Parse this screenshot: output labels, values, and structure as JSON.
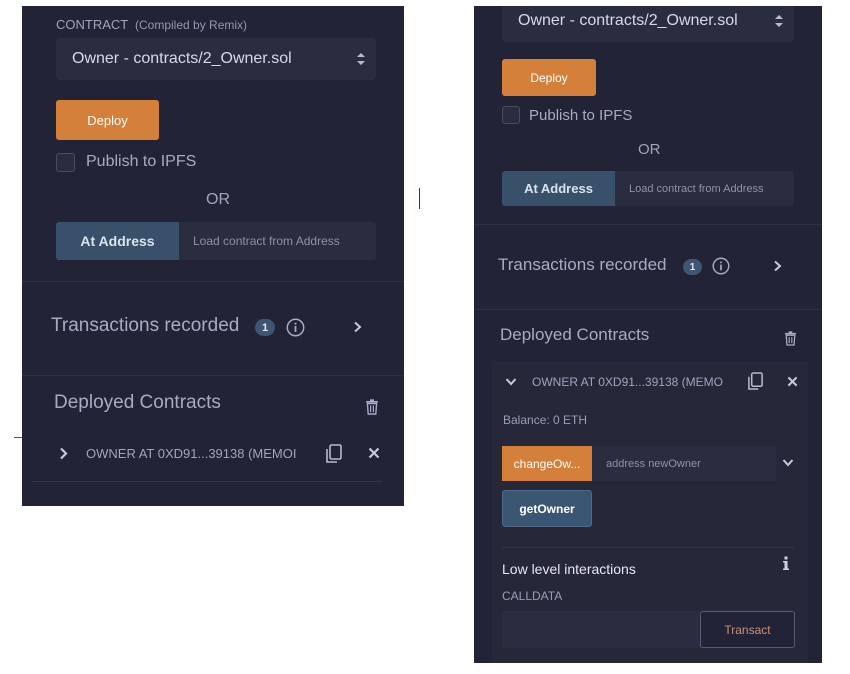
{
  "left": {
    "contract_label": "CONTRACT",
    "compiled_note": "(Compiled by Remix)",
    "contract_select": "Owner - contracts/2_Owner.sol",
    "deploy_label": "Deploy",
    "publish_label": "Publish to IPFS",
    "or_label": "OR",
    "at_address_label": "At Address",
    "address_placeholder": "Load contract from Address",
    "transactions_title": "Transactions recorded",
    "transactions_count": "1",
    "deployed_title": "Deployed Contracts",
    "deployed_contract": "OWNER AT 0XD91...39138 (MEMOI"
  },
  "right": {
    "contract_select": "Owner - contracts/2_Owner.sol",
    "deploy_label": "Deploy",
    "publish_label": "Publish to IPFS",
    "or_label": "OR",
    "at_address_label": "At Address",
    "address_placeholder": "Load contract from Address",
    "transactions_title": "Transactions recorded",
    "transactions_count": "1",
    "deployed_title": "Deployed Contracts",
    "deployed_contract": "OWNER AT 0XD91...39138 (MEMO",
    "balance": "Balance: 0 ETH",
    "change_owner_label": "changeOw...",
    "change_owner_placeholder": "address newOwner",
    "get_owner_label": "getOwner",
    "low_level_title": "Low level interactions",
    "calldata_label": "CALLDATA",
    "transact_label": "Transact"
  },
  "colors": {
    "panel_bg": "#222336",
    "deploy_orange": "#d5803a",
    "at_address_blue": "#39506a",
    "get_owner_blue": "#3b5672"
  },
  "icons": [
    "select-arrows-icon",
    "info-icon",
    "chevron-right-icon",
    "chevron-down-icon",
    "copy-icon",
    "close-icon",
    "trash-icon"
  ]
}
